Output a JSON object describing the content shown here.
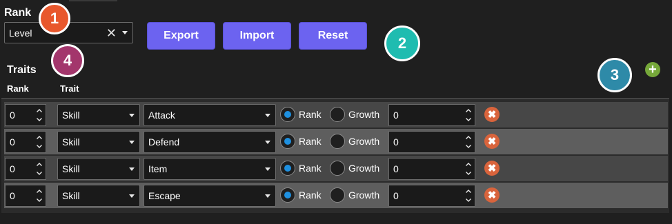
{
  "rank_section": {
    "title": "Rank",
    "dropdown_value": "Level",
    "clear_glyph": "✕"
  },
  "toolbar": {
    "export_label": "Export",
    "import_label": "Import",
    "reset_label": "Reset"
  },
  "badges": {
    "b1": "1",
    "b2": "2",
    "b3": "3",
    "b4": "4"
  },
  "badge_colors": {
    "b1": "#e8572c",
    "b2": "#1fbcb0",
    "b3": "#2e8aa8",
    "b4": "#a3366c"
  },
  "traits": {
    "title": "Traits",
    "col_rank": "Rank",
    "col_trait": "Trait",
    "add_glyph": "+",
    "rows": [
      {
        "rank": "0",
        "type": "Skill",
        "name": "Attack",
        "mode_rank": "Rank",
        "mode_growth": "Growth",
        "value": "0",
        "selected": "rank"
      },
      {
        "rank": "0",
        "type": "Skill",
        "name": "Defend",
        "mode_rank": "Rank",
        "mode_growth": "Growth",
        "value": "0",
        "selected": "rank"
      },
      {
        "rank": "0",
        "type": "Skill",
        "name": "Item",
        "mode_rank": "Rank",
        "mode_growth": "Growth",
        "value": "0",
        "selected": "rank"
      },
      {
        "rank": "0",
        "type": "Skill",
        "name": "Escape",
        "mode_rank": "Rank",
        "mode_growth": "Growth",
        "value": "0",
        "selected": "rank"
      }
    ],
    "delete_glyph": "✖"
  },
  "colors": {
    "accent_button": "#6c63f0",
    "radio_selected": "#1e90e0",
    "add_icon": "#76a83a",
    "delete_icon": "#d9643c"
  }
}
